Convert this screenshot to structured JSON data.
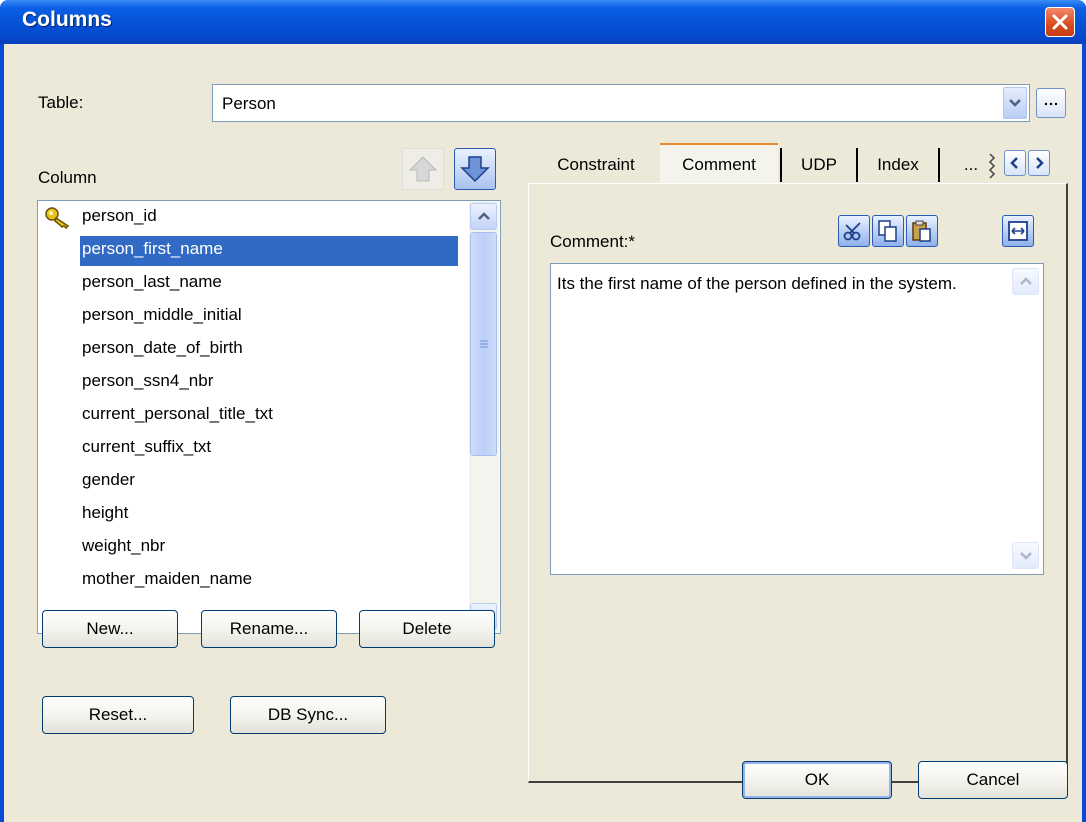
{
  "window": {
    "title": "Columns"
  },
  "table_field": {
    "label": "Table:",
    "value": "Person"
  },
  "columns": {
    "label": "Column",
    "items": [
      {
        "name": "person_id",
        "key": true
      },
      {
        "name": "person_first_name",
        "selected": true
      },
      {
        "name": "person_last_name"
      },
      {
        "name": "person_middle_initial"
      },
      {
        "name": "person_date_of_birth"
      },
      {
        "name": "person_ssn4_nbr"
      },
      {
        "name": "current_personal_title_txt"
      },
      {
        "name": "current_suffix_txt"
      },
      {
        "name": "gender"
      },
      {
        "name": "height"
      },
      {
        "name": "weight_nbr"
      },
      {
        "name": "mother_maiden_name"
      }
    ]
  },
  "column_buttons": {
    "new": "New...",
    "rename": "Rename...",
    "delete": "Delete",
    "reset": "Reset...",
    "db_sync": "DB Sync..."
  },
  "tabs": [
    "Constraint",
    "Comment",
    "UDP",
    "Index",
    "..."
  ],
  "active_tab": "Comment",
  "comment": {
    "label": "Comment:*",
    "text": "Its the first name of the person defined in the system."
  },
  "dialog_buttons": {
    "ok": "OK",
    "cancel": "Cancel"
  },
  "colors": {
    "title_bar": "#0653d6",
    "selection": "#316ac5",
    "dialog_bg": "#ece9d8",
    "close_button": "#d94a1e"
  }
}
